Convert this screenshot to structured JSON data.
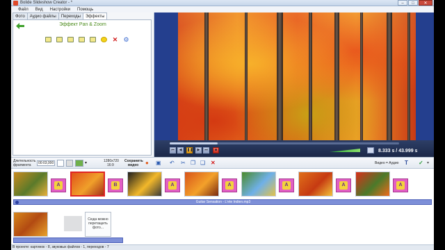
{
  "window": {
    "title": "Bolide Slideshow Creator - *",
    "minimize": "–",
    "maximize": "□",
    "close": "✕"
  },
  "menu": [
    "Файл",
    "Вид",
    "Настройки",
    "Помощь"
  ],
  "tabs": [
    "Фото",
    "Аудио файлы",
    "Переходы",
    "Эффекты"
  ],
  "active_tab": "Эффекты",
  "effects_panel": {
    "title": "Эффект Pan & Zoom",
    "tools": [
      "zoom-in-icon",
      "zoom-out-icon",
      "pan-left-icon",
      "pan-up-icon",
      "pan-down-icon",
      "sun-icon",
      "delete-icon",
      "settings-icon"
    ]
  },
  "player": {
    "time": "8.333 s / 43.999 s",
    "progress": 0.21,
    "buttons": [
      "⏮",
      "◀",
      "❚❚",
      "▶",
      "⏭",
      "■"
    ],
    "volume": 0.7
  },
  "toolbar": {
    "duration_label_1": "Длительность",
    "duration_label_2": "фрагмента",
    "duration_value": "00:03,000",
    "resolution_1": "1280x720",
    "resolution_2": "16:9",
    "save_1": "Сохранить",
    "save_2": "видео",
    "video_audio": "Видео = Аудио",
    "text_tool": "T",
    "check": "✓"
  },
  "storyboard": {
    "slides": [
      {
        "kind": "photo",
        "palette": [
          "#c98a1e",
          "#5a7a2a",
          "#e8b03a"
        ]
      },
      {
        "kind": "photo",
        "palette": [
          "#e0541a",
          "#f0a02a",
          "#a6301a"
        ],
        "selected": true
      },
      {
        "kind": "photo",
        "palette": [
          "#1e1e1e",
          "#f2b82a",
          "#3a3a3a"
        ]
      },
      {
        "kind": "photo",
        "palette": [
          "#d8541a",
          "#f3a12a",
          "#7a2a12"
        ]
      },
      {
        "kind": "photo",
        "palette": [
          "#4a8a2a",
          "#6fb0e8",
          "#e2c24a"
        ]
      },
      {
        "kind": "photo",
        "palette": [
          "#e0701a",
          "#c63a12",
          "#f2c23a"
        ]
      },
      {
        "kind": "photo",
        "palette": [
          "#d8301a",
          "#4a7a2a",
          "#f06a1a"
        ]
      }
    ],
    "transition_letters": [
      "A",
      "B",
      "A",
      "A",
      "A",
      "A",
      "A"
    ],
    "audio_track": "Guitar Sensation - L'ete Indien.mp3",
    "drop_hint": "Сюда можно перетащить фото..."
  },
  "status": "В проекте: картинок - 8, звуковых файлов - 1, переходов - 7"
}
